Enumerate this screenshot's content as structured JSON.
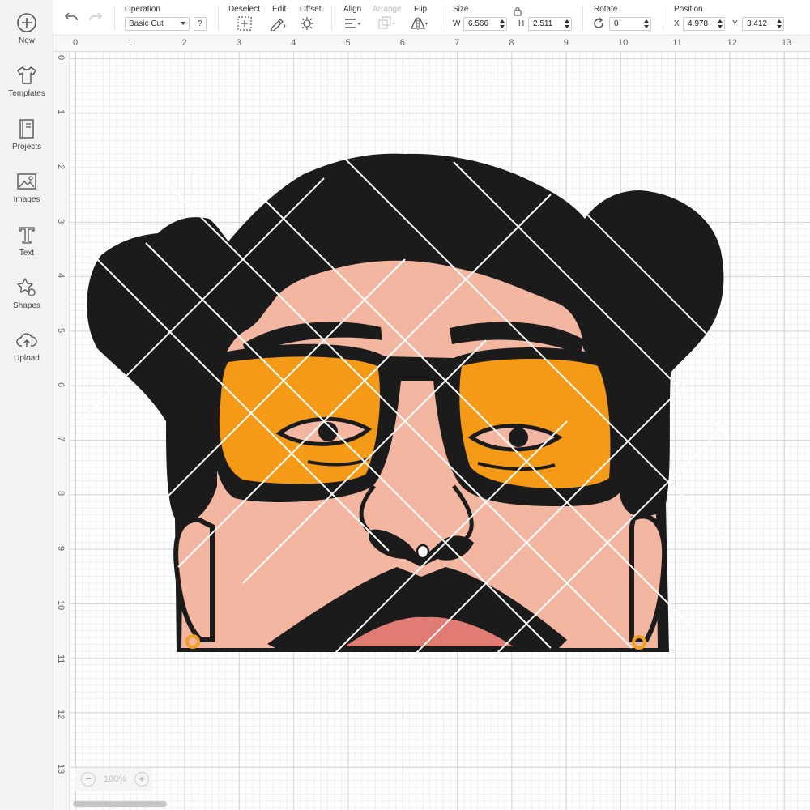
{
  "sidebar": {
    "items": [
      {
        "label": "New",
        "icon": "plus-circle-icon"
      },
      {
        "label": "Templates",
        "icon": "tshirt-icon"
      },
      {
        "label": "Projects",
        "icon": "notebook-icon"
      },
      {
        "label": "Images",
        "icon": "image-icon"
      },
      {
        "label": "Text",
        "icon": "text-t-icon"
      },
      {
        "label": "Shapes",
        "icon": "shapes-icon"
      },
      {
        "label": "Upload",
        "icon": "cloud-upload-icon"
      }
    ]
  },
  "toolbar": {
    "operation": {
      "label": "Operation",
      "value": "Basic Cut",
      "help": "?"
    },
    "deselect": {
      "label": "Deselect"
    },
    "edit": {
      "label": "Edit"
    },
    "offset": {
      "label": "Offset"
    },
    "align": {
      "label": "Align"
    },
    "arrange": {
      "label": "Arrange"
    },
    "flip": {
      "label": "Flip"
    },
    "size": {
      "label": "Size",
      "w_label": "W",
      "w_value": "6.566",
      "h_label": "H",
      "h_value": "2.511"
    },
    "rotate": {
      "label": "Rotate",
      "value": "0"
    },
    "position": {
      "label": "Position",
      "x_label": "X",
      "x_value": "4.978",
      "y_label": "Y",
      "y_value": "3.412"
    }
  },
  "rulers": {
    "top": [
      "0",
      "1",
      "2",
      "3",
      "4",
      "5",
      "6",
      "7",
      "8",
      "9",
      "10",
      "11",
      "12",
      "13"
    ],
    "left": [
      "0",
      "1",
      "2",
      "3",
      "4",
      "5",
      "6",
      "7",
      "8",
      "9",
      "10",
      "11",
      "12",
      "13"
    ]
  },
  "zoom": {
    "value": "100%",
    "minus": "−",
    "plus": "+"
  },
  "colors": {
    "hair": "#1b1b1b",
    "skin": "#f3b6a1",
    "lens": "#f59a16",
    "lips": "#e07c73",
    "earring": "#f0a020",
    "grid_major": "#d6d6d6",
    "grid_minor": "#eeeeee"
  }
}
